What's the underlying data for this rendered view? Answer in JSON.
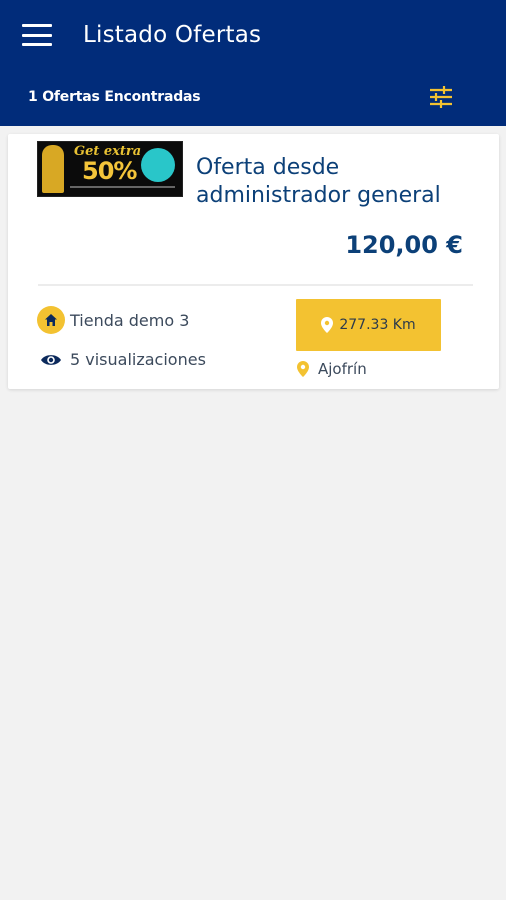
{
  "header": {
    "title": "Listado Ofertas",
    "result_count": "1 Ofertas Encontradas"
  },
  "offers": [
    {
      "banner": {
        "top_text": "Get extra",
        "big_text": "50%"
      },
      "title": "Oferta desde administrador general",
      "price": "120,00 €",
      "store": "Tienda demo 3",
      "views": "5 visualizaciones",
      "distance": "277.33 Km",
      "city": "Ajofrín"
    }
  ],
  "icons": {
    "menu": "hamburger-menu-icon",
    "filter": "tune-sliders-icon",
    "store": "home-icon",
    "views": "eye-icon",
    "location": "map-pin-icon"
  },
  "colors": {
    "header_bg": "#012c7a",
    "accent": "#f3c231",
    "text_primary": "#0c4078",
    "text_secondary": "#3c4a5c",
    "background": "#f2f2f2"
  }
}
